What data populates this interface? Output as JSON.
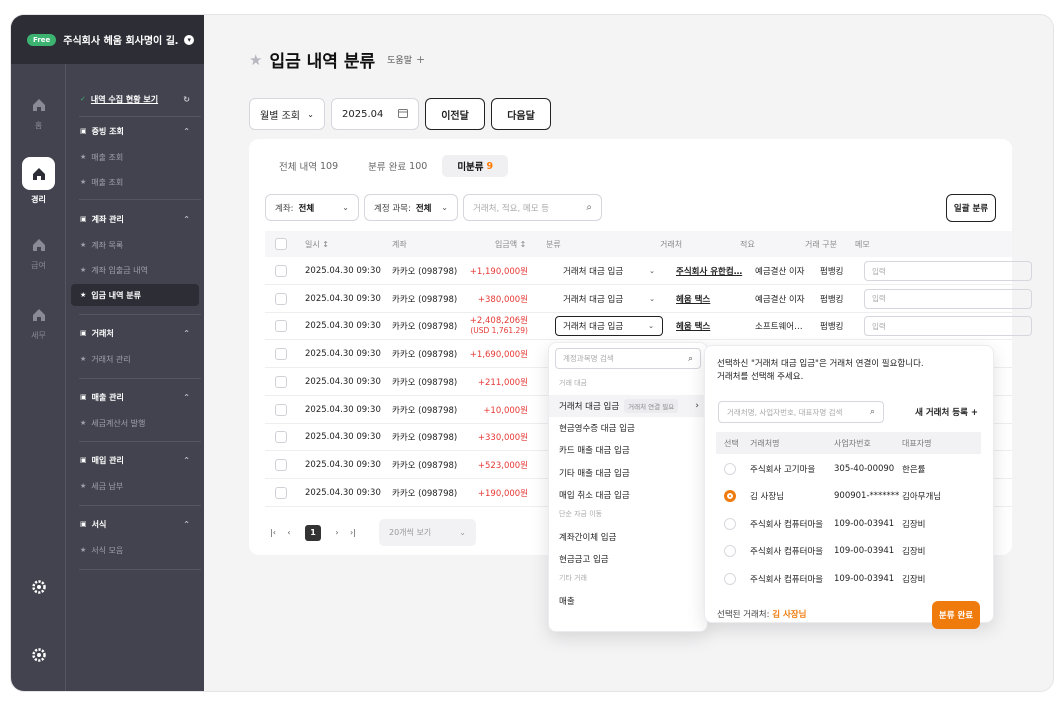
{
  "org": {
    "badge": "Free",
    "name": "주식회사 헤움 회사명이 길…"
  },
  "rail": [
    {
      "label": "홈"
    },
    {
      "label": "경리"
    },
    {
      "label": "급여"
    },
    {
      "label": "세무"
    }
  ],
  "menu": {
    "collect": "내역 수집 현황 보기",
    "sections": [
      {
        "title": "증빙 조회",
        "items": [
          "매출 조회",
          "매출 조회"
        ]
      },
      {
        "title": "계좌 관리",
        "items": [
          "계좌 목록",
          "계좌 입출금 내역",
          "입금 내역 분류"
        ]
      },
      {
        "title": "거래처",
        "items": [
          "거래처 관리"
        ]
      },
      {
        "title": "매출 관리",
        "items": [
          "세금계산서 발행"
        ]
      },
      {
        "title": "매입 관리",
        "items": [
          "세금 납부"
        ]
      },
      {
        "title": "서식",
        "items": [
          "서식 모음"
        ]
      }
    ]
  },
  "page": {
    "title": "입금 내역 분류",
    "help": "도움말",
    "help_plus": "+"
  },
  "controls": {
    "period": "월별 조회",
    "month": "2025.04",
    "prev": "이전달",
    "next": "다음달"
  },
  "tabs": [
    {
      "label": "전체 내역",
      "count": "109"
    },
    {
      "label": "분류 완료",
      "count": "100"
    },
    {
      "label": "미분류",
      "count": "9"
    }
  ],
  "filters": {
    "account_label": "계좌:",
    "account_value": "전체",
    "subject_label": "계정 과목:",
    "subject_value": "전체",
    "search_placeholder": "거래처, 적요, 메모 등",
    "bulk": "일괄 분류"
  },
  "columns": [
    "일시 ↕",
    "계좌",
    "입금액 ↕",
    "분류",
    "거래처",
    "적요",
    "거래 구분",
    "메모"
  ],
  "memo_placeholder": "입력",
  "rows": [
    {
      "date": "2025.04.30  09:30",
      "account": "카카오 (098798)",
      "amount": "+1,190,000원",
      "usd": "",
      "class": "거래처 대금 입금",
      "vendor": "주식회사 유한컴…",
      "desc": "예금결산 이자",
      "type": "펌뱅킹"
    },
    {
      "date": "2025.04.30  09:30",
      "account": "카카오 (098798)",
      "amount": "+380,000원",
      "usd": "",
      "class": "거래처 대금 입금",
      "vendor": "헤움 택스",
      "desc": "예금결산 이자",
      "type": "펌뱅킹"
    },
    {
      "date": "2025.04.30  09:30",
      "account": "카카오 (098798)",
      "amount": "+2,408,206원",
      "usd": "(USD 1,761.29)",
      "class": "거래처 대금 입금",
      "vendor": "헤움 택스",
      "desc": "소프트웨어…",
      "type": "펌뱅킹"
    },
    {
      "date": "2025.04.30  09:30",
      "account": "카카오 (098798)",
      "amount": "+1,690,000원",
      "usd": "",
      "class": "",
      "vendor": "",
      "desc": "",
      "type": ""
    },
    {
      "date": "2025.04.30  09:30",
      "account": "카카오 (098798)",
      "amount": "+211,000원",
      "usd": "",
      "class": "",
      "vendor": "",
      "desc": "",
      "type": ""
    },
    {
      "date": "2025.04.30  09:30",
      "account": "카카오 (098798)",
      "amount": "+10,000원",
      "usd": "",
      "class": "",
      "vendor": "",
      "desc": "",
      "type": ""
    },
    {
      "date": "2025.04.30  09:30",
      "account": "카카오 (098798)",
      "amount": "+330,000원",
      "usd": "",
      "class": "",
      "vendor": "",
      "desc": "",
      "type": ""
    },
    {
      "date": "2025.04.30  09:30",
      "account": "카카오 (098798)",
      "amount": "+523,000원",
      "usd": "",
      "class": "",
      "vendor": "",
      "desc": "",
      "type": ""
    },
    {
      "date": "2025.04.30  09:30",
      "account": "카카오 (098798)",
      "amount": "+190,000원",
      "usd": "",
      "class": "",
      "vendor": "",
      "desc": "",
      "type": ""
    }
  ],
  "pager": {
    "first": "|‹",
    "prev": "‹",
    "current": "1",
    "next": "›",
    "last": "›|",
    "per_page": "20개씩 보기"
  },
  "dropdown": {
    "search_placeholder": "계정과목명 검색",
    "items": [
      {
        "kind": "group",
        "label": "거래 대금"
      },
      {
        "kind": "item",
        "label": "거래처 대금 입금",
        "tag": "거래처 연결 필요",
        "hl": true
      },
      {
        "kind": "item",
        "label": "현금영수증 대금 입금"
      },
      {
        "kind": "item",
        "label": "카드 매출 대금 입금"
      },
      {
        "kind": "item",
        "label": "기타 매출 대금 입금"
      },
      {
        "kind": "item",
        "label": "매입 취소 대금 입금"
      },
      {
        "kind": "group",
        "label": "단순 자금 이동"
      },
      {
        "kind": "item",
        "label": "계좌간이체 입금"
      },
      {
        "kind": "item",
        "label": "현금금고 입금"
      },
      {
        "kind": "group",
        "label": "기타 거래"
      },
      {
        "kind": "item",
        "label": "매출"
      }
    ]
  },
  "vendor_panel": {
    "msg1": "선택하신 \"거래처 대금 입금\"은 거래처 연결이 필요합니다.",
    "msg2": "거래처를 선택해 주세요.",
    "search_placeholder": "거래처명, 사업자번호, 대표자명 검색",
    "new": "새 거래처 등록  +",
    "columns": [
      "선택",
      "거래처명",
      "사업자번호",
      "대표자명"
    ],
    "rows": [
      {
        "name": "주식회사 고기마을",
        "biz": "305-40-00090",
        "ceo": "한은률",
        "on": false
      },
      {
        "name": "김 사장님",
        "biz": "900901-*******",
        "ceo": "김아무개님",
        "on": true
      },
      {
        "name": "주식회사 컴퓨터마을",
        "biz": "109-00-03941",
        "ceo": "김장비",
        "on": false
      },
      {
        "name": "주식회사 컴퓨터마을",
        "biz": "109-00-03941",
        "ceo": "김장비",
        "on": false
      },
      {
        "name": "주식회사 컴퓨터마을",
        "biz": "109-00-03941",
        "ceo": "김장비",
        "on": false
      }
    ],
    "footer_label": "선택된 거래처: ",
    "footer_value": "김 사장님",
    "done": "분류 완료"
  },
  "colors": {
    "accent": "#f07b0d",
    "amount": "#e53935",
    "sidebar": "#43434f"
  }
}
